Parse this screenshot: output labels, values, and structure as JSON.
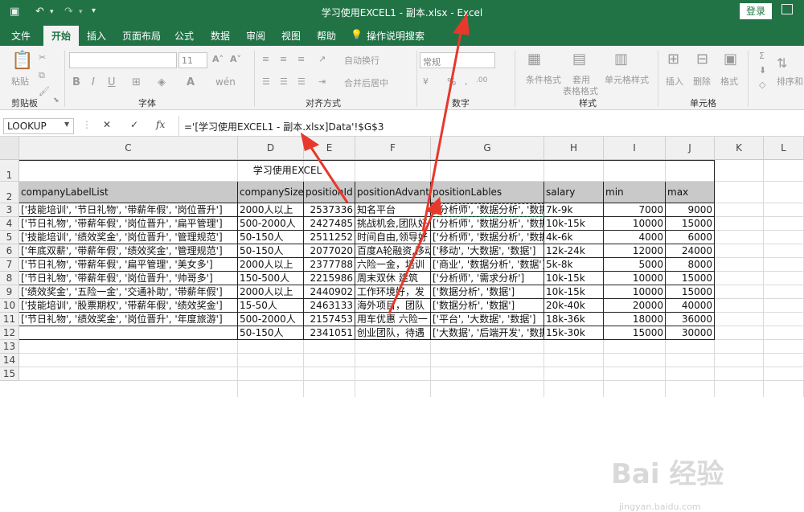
{
  "app": {
    "title": "学习使用EXCEL1 - 副本.xlsx  -  Excel",
    "login": "登录",
    "accent": "#217346"
  },
  "tabs": [
    "文件",
    "开始",
    "插入",
    "页面布局",
    "公式",
    "数据",
    "审阅",
    "视图",
    "帮助",
    "操作说明搜索"
  ],
  "ribbon": {
    "groups": [
      "剪贴板",
      "字体",
      "对齐方式",
      "数字",
      "样式",
      "单元格"
    ],
    "paste": "粘贴",
    "font_size": "11",
    "wrap_text": "自动换行",
    "merge_center": "合并后居中",
    "number_format": "常规",
    "cond_format": "条件格式",
    "table_format_1": "套用",
    "table_format_2": "表格格式",
    "cell_styles": "单元格样式",
    "insert": "插入",
    "delete": "删除",
    "format": "格式",
    "sort": "排序和"
  },
  "formula_bar": {
    "name_box": "LOOKUP",
    "formula": "='[学习使用EXCEL1 - 副本.xlsx]Data'!$G$3"
  },
  "columns": [
    "C",
    "D",
    "E",
    "F",
    "G",
    "H",
    "I",
    "J",
    "K",
    "L"
  ],
  "rows": [
    "1",
    "2",
    "3",
    "4",
    "5",
    "6",
    "7",
    "8",
    "9",
    "10",
    "11",
    "12",
    "13",
    "14",
    "15"
  ],
  "sheet": {
    "title": "学习使用EXCEL",
    "headers": [
      "companyLabelList",
      "companySize",
      "positionId",
      "positionAdvantage",
      "positionLables",
      "salary",
      "min",
      "max"
    ],
    "data": [
      [
        "['技能培训', '节日礼物', '带薪年假', '岗位晋升']",
        "2000人以上",
        "2537336",
        "知名平台",
        "['分析师', '数据分析', '数据",
        "7k-9k",
        "7000",
        "9000"
      ],
      [
        "['节日礼物', '带薪年假', '岗位晋升', '扁平管理']",
        "500-2000人",
        "2427485",
        "挑战机会,团队好",
        "['分析师', '数据分析', '数据",
        "10k-15k",
        "10000",
        "15000"
      ],
      [
        "['技能培训', '绩效奖金', '岗位晋升', '管理规范']",
        "50-150人",
        "2511252",
        "时间自由,领导好",
        "['分析师', '数据分析', '数据",
        "4k-6k",
        "4000",
        "6000"
      ],
      [
        "['年底双薪', '带薪年假', '绩效奖金', '管理规范']",
        "50-150人",
        "2077020",
        "百度A轮融资,移动",
        "['移动', '大数据', '数据']",
        "12k-24k",
        "12000",
        "24000"
      ],
      [
        "['节日礼物', '带薪年假', '扁平管理', '美女多']",
        "2000人以上",
        "2377788",
        "六险一金，培训",
        "['商业', '数据分析', '数据']",
        "5k-8k",
        "5000",
        "8000"
      ],
      [
        "['节日礼物', '带薪年假', '岗位晋升', '帅哥多']",
        "150-500人",
        "2215986",
        "周末双休 建筑",
        "['分析师', '需求分析']",
        "10k-15k",
        "10000",
        "15000"
      ],
      [
        "['绩效奖金', '五险一金', '交通补助', '带薪年假']",
        "2000人以上",
        "2440902",
        "工作环境好，发",
        "['数据分析', '数据']",
        "10k-15k",
        "10000",
        "15000"
      ],
      [
        "['技能培训', '股票期权', '带薪年假', '绩效奖金']",
        "15-50人",
        "2463133",
        "海外项目，团队",
        "['数据分析', '数据']",
        "20k-40k",
        "20000",
        "40000"
      ],
      [
        "['节日礼物', '绩效奖金', '岗位晋升', '年度旅游']",
        "500-2000人",
        "2157453",
        "用车优惠 六险一",
        "['平台', '大数据', '数据']",
        "18k-36k",
        "18000",
        "36000"
      ],
      [
        "",
        "50-150人",
        "2341051",
        "创业团队，待遇",
        "['大数据', '后端开发', '数据",
        "15k-30k",
        "15000",
        "30000"
      ]
    ]
  },
  "watermark": {
    "logo": "Bai 经验",
    "url": "jingyan.baidu.com"
  },
  "annotation_color": "#e8382c"
}
